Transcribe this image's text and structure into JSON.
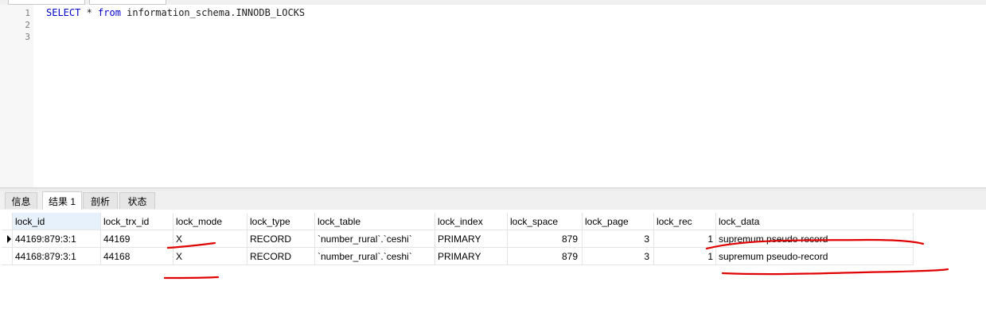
{
  "editor": {
    "line_numbers": [
      "1",
      "2",
      "3"
    ],
    "query": {
      "kw_select": "SELECT",
      "star": " * ",
      "kw_from": "from",
      "table": " information_schema.INNODB_LOCKS"
    }
  },
  "result_tabs": [
    {
      "label": "信息"
    },
    {
      "label": "结果 1"
    },
    {
      "label": "剖析"
    },
    {
      "label": "状态"
    }
  ],
  "grid": {
    "columns": [
      "lock_id",
      "lock_trx_id",
      "lock_mode",
      "lock_type",
      "lock_table",
      "lock_index",
      "lock_space",
      "lock_page",
      "lock_rec",
      "lock_data"
    ],
    "rows": [
      [
        "44169:879:3:1",
        "44169",
        "X",
        "RECORD",
        "`number_rural`.`ceshi`",
        "PRIMARY",
        "879",
        "3",
        "1",
        "supremum pseudo-record"
      ],
      [
        "44168:879:3:1",
        "44168",
        "X",
        "RECORD",
        "`number_rural`.`ceshi`",
        "PRIMARY",
        "879",
        "3",
        "1",
        "supremum pseudo-record"
      ]
    ]
  },
  "colors": {
    "keyword": "#0000cc",
    "annotation": "#e00000",
    "selected_header": "#e7f1fb"
  }
}
